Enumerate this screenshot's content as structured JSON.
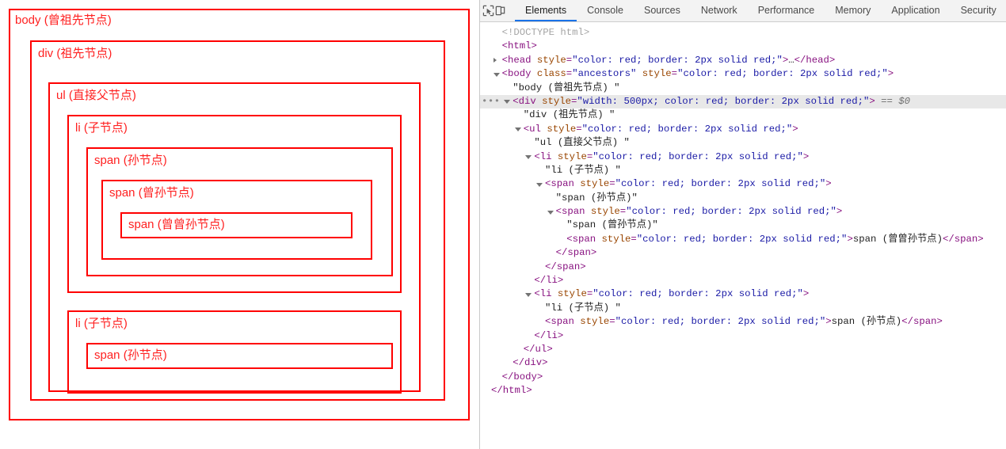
{
  "page_pane": {
    "boxes": [
      {
        "label": "body (曾祖先节点)"
      },
      {
        "label": "div (祖先节点)"
      },
      {
        "label": "ul (直接父节点)"
      },
      {
        "label": "li (子节点)"
      },
      {
        "label": "span (孙节点)"
      },
      {
        "label": "span (曾孙节点)"
      },
      {
        "label": "span (曾曾孙节点)"
      },
      {
        "label": "li (子节点)"
      },
      {
        "label": "span (孙节点)"
      }
    ],
    "border_color": "#ff0000",
    "text_color": "#ff2020"
  },
  "devtools": {
    "toolbar": {
      "inspect_icon": "inspect-cursor-icon",
      "device_icon": "device-toolbar-icon"
    },
    "tabs": [
      {
        "label": "Elements",
        "active": true
      },
      {
        "label": "Console",
        "active": false
      },
      {
        "label": "Sources",
        "active": false
      },
      {
        "label": "Network",
        "active": false
      },
      {
        "label": "Performance",
        "active": false
      },
      {
        "label": "Memory",
        "active": false
      },
      {
        "label": "Application",
        "active": false
      },
      {
        "label": "Security",
        "active": false
      }
    ],
    "active_tab_underline": "#1a73e8",
    "selected_row_background": "#e8e8e8",
    "style_value": "color: red; border: 2px solid red;",
    "dom_rows": [
      {
        "indent": 1,
        "marker": "none",
        "kind": "doctype",
        "text": "<!DOCTYPE html>"
      },
      {
        "indent": 1,
        "marker": "none",
        "kind": "tagline",
        "tag": "html",
        "attrs": []
      },
      {
        "indent": 1,
        "marker": "closed",
        "kind": "collapsed",
        "tag": "head",
        "attrs": [
          {
            "name": "style",
            "value": "color: red; border: 2px solid red;"
          }
        ],
        "collapsed_text": "…",
        "close_tag": "</head>"
      },
      {
        "indent": 1,
        "marker": "open",
        "kind": "tagline",
        "tag": "body",
        "attrs": [
          {
            "name": "class",
            "value": "ancestors"
          },
          {
            "name": "style",
            "value": "color: red; border: 2px solid red;"
          }
        ]
      },
      {
        "indent": 2,
        "marker": "none",
        "kind": "text",
        "text": "\"body (曾祖先节点) \""
      },
      {
        "indent": 2,
        "marker": "open",
        "kind": "tagline",
        "tag": "div",
        "selected": true,
        "dots": true,
        "suffix": " == $0",
        "attrs": [
          {
            "name": "style",
            "value": "width: 500px; color: red; border: 2px solid red;"
          }
        ]
      },
      {
        "indent": 3,
        "marker": "none",
        "kind": "text",
        "text": "\"div (祖先节点) \""
      },
      {
        "indent": 3,
        "marker": "open",
        "kind": "tagline",
        "tag": "ul",
        "attrs": [
          {
            "name": "style",
            "value": "color: red; border: 2px solid red;"
          }
        ]
      },
      {
        "indent": 4,
        "marker": "none",
        "kind": "text",
        "text": "\"ul (直接父节点) \""
      },
      {
        "indent": 4,
        "marker": "open",
        "kind": "tagline",
        "tag": "li",
        "attrs": [
          {
            "name": "style",
            "value": "color: red; border: 2px solid red;"
          }
        ]
      },
      {
        "indent": 5,
        "marker": "none",
        "kind": "text",
        "text": "\"li (子节点) \""
      },
      {
        "indent": 5,
        "marker": "open",
        "kind": "tagline",
        "tag": "span",
        "attrs": [
          {
            "name": "style",
            "value": "color: red; border: 2px solid red;"
          }
        ]
      },
      {
        "indent": 6,
        "marker": "none",
        "kind": "text",
        "text": "\"span (孙节点)\""
      },
      {
        "indent": 6,
        "marker": "open",
        "kind": "tagline",
        "tag": "span",
        "attrs": [
          {
            "name": "style",
            "value": "color: red; border: 2px solid red;"
          }
        ]
      },
      {
        "indent": 7,
        "marker": "none",
        "kind": "text",
        "text": "\"span (曾孙节点)\""
      },
      {
        "indent": 7,
        "marker": "none",
        "kind": "inline",
        "tag": "span",
        "attrs": [
          {
            "name": "style",
            "value": "color: red; border: 2px solid red;"
          }
        ],
        "inner_text": "span (曾曾孙节点)",
        "close_tag": "</span>"
      },
      {
        "indent": 6,
        "marker": "none",
        "kind": "closetag",
        "text": "</span>"
      },
      {
        "indent": 5,
        "marker": "none",
        "kind": "closetag",
        "text": "</span>"
      },
      {
        "indent": 4,
        "marker": "none",
        "kind": "closetag",
        "text": "</li>"
      },
      {
        "indent": 4,
        "marker": "open",
        "kind": "tagline",
        "tag": "li",
        "attrs": [
          {
            "name": "style",
            "value": "color: red; border: 2px solid red;"
          }
        ]
      },
      {
        "indent": 5,
        "marker": "none",
        "kind": "text",
        "text": "\"li (子节点) \""
      },
      {
        "indent": 5,
        "marker": "none",
        "kind": "inline",
        "tag": "span",
        "attrs": [
          {
            "name": "style",
            "value": "color: red; border: 2px solid red;"
          }
        ],
        "inner_text": "span (孙节点)",
        "close_tag": "</span>"
      },
      {
        "indent": 4,
        "marker": "none",
        "kind": "closetag",
        "text": "</li>"
      },
      {
        "indent": 3,
        "marker": "none",
        "kind": "closetag",
        "text": "</ul>"
      },
      {
        "indent": 2,
        "marker": "none",
        "kind": "closetag",
        "text": "</div>"
      },
      {
        "indent": 1,
        "marker": "none",
        "kind": "closetag",
        "text": "</body>"
      },
      {
        "indent": 0,
        "marker": "none",
        "kind": "closetag",
        "text": "</html>"
      }
    ]
  }
}
